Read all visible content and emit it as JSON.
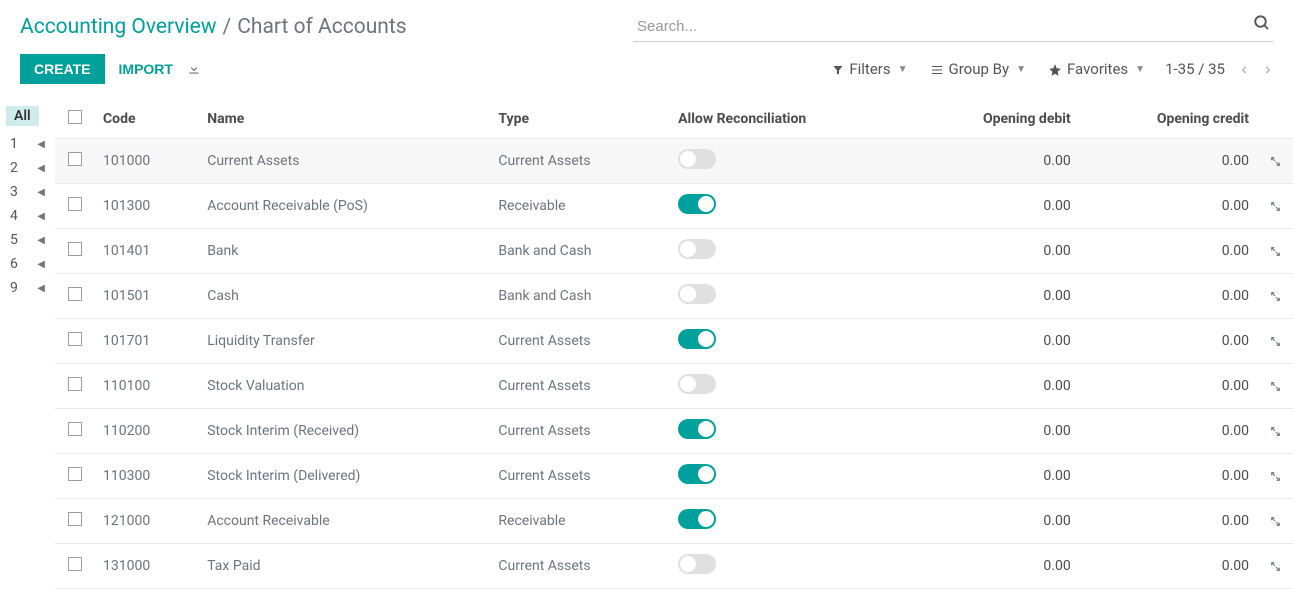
{
  "breadcrumb": {
    "root": "Accounting Overview",
    "separator": "/",
    "current": "Chart of Accounts"
  },
  "search": {
    "placeholder": "Search..."
  },
  "toolbar": {
    "create": "CREATE",
    "import": "IMPORT",
    "filters": "Filters",
    "group_by": "Group By",
    "favorites": "Favorites",
    "pager": "1-35 / 35"
  },
  "sidebar": {
    "all": "All",
    "items": [
      "1",
      "2",
      "3",
      "4",
      "5",
      "6",
      "9"
    ]
  },
  "columns": {
    "code": "Code",
    "name": "Name",
    "type": "Type",
    "reconcile": "Allow Reconciliation",
    "opening_debit": "Opening debit",
    "opening_credit": "Opening credit"
  },
  "rows": [
    {
      "code": "101000",
      "name": "Current Assets",
      "type": "Current Assets",
      "reconcile": false,
      "debit": "0.00",
      "credit": "0.00"
    },
    {
      "code": "101300",
      "name": "Account Receivable (PoS)",
      "type": "Receivable",
      "reconcile": true,
      "debit": "0.00",
      "credit": "0.00"
    },
    {
      "code": "101401",
      "name": "Bank",
      "type": "Bank and Cash",
      "reconcile": false,
      "debit": "0.00",
      "credit": "0.00"
    },
    {
      "code": "101501",
      "name": "Cash",
      "type": "Bank and Cash",
      "reconcile": false,
      "debit": "0.00",
      "credit": "0.00"
    },
    {
      "code": "101701",
      "name": "Liquidity Transfer",
      "type": "Current Assets",
      "reconcile": true,
      "debit": "0.00",
      "credit": "0.00"
    },
    {
      "code": "110100",
      "name": "Stock Valuation",
      "type": "Current Assets",
      "reconcile": false,
      "debit": "0.00",
      "credit": "0.00"
    },
    {
      "code": "110200",
      "name": "Stock Interim (Received)",
      "type": "Current Assets",
      "reconcile": true,
      "debit": "0.00",
      "credit": "0.00"
    },
    {
      "code": "110300",
      "name": "Stock Interim (Delivered)",
      "type": "Current Assets",
      "reconcile": true,
      "debit": "0.00",
      "credit": "0.00"
    },
    {
      "code": "121000",
      "name": "Account Receivable",
      "type": "Receivable",
      "reconcile": true,
      "debit": "0.00",
      "credit": "0.00"
    },
    {
      "code": "131000",
      "name": "Tax Paid",
      "type": "Current Assets",
      "reconcile": false,
      "debit": "0.00",
      "credit": "0.00"
    }
  ]
}
